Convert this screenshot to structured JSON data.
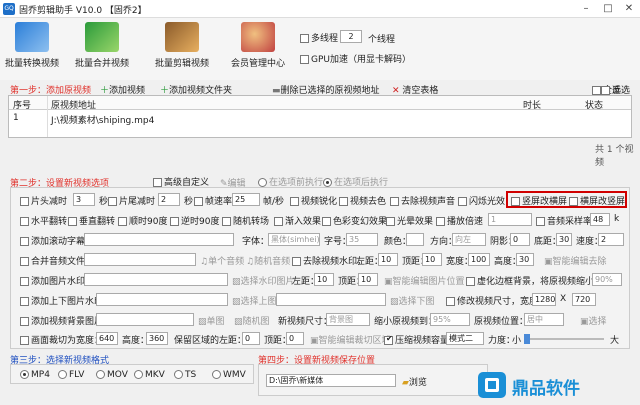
{
  "window": {
    "title": "固乔剪辑助手 V10.0 【固乔2】",
    "logo": "GQ",
    "min": "–",
    "max": "□",
    "close": "✕"
  },
  "toolbar": {
    "buttons": [
      "批量转换视频",
      "批量合并视频",
      "批量剪辑视频",
      "会员管理中心"
    ],
    "multithread": "多线程",
    "thread_count": "2",
    "thread_unit": "个线程",
    "gpu": "GPU加速（用显卡解码）"
  },
  "step1": {
    "title": "第一步：添加原视频",
    "add_video": "添加视频",
    "add_folder": "添加视频文件夹",
    "delete_selected": "删除已选择的原视频地址",
    "clear": "清空表格",
    "select_all": "全选",
    "invert": "反选"
  },
  "grid": {
    "headers": [
      "序号",
      "原视频地址",
      "时长",
      "状态"
    ],
    "rows": [
      {
        "no": "1",
        "path": "J:\\视频素材\\shiping.mp4",
        "duration": "",
        "status": ""
      }
    ],
    "count": "共 1 个视频"
  },
  "step2": {
    "title": "第二步：设置新视频选项",
    "advanced": "高级自定义",
    "edit": "编辑",
    "before": "在选项前执行",
    "after": "在选项后执行"
  },
  "row1": {
    "cut_head": "片头减时",
    "cut_head_val": "3",
    "sec1": "秒",
    "cut_tail": "片尾减时",
    "cut_tail_val": "2",
    "sec2": "秒",
    "fps": "帧速率：",
    "fps_val": "25",
    "fps_unit": "帧/秒",
    "sharpen": "视频锐化",
    "decolor": "视频去色",
    "mute": "去除视频声音",
    "flash": "闪烁光效",
    "v2h": "竖屏改横屏",
    "h2v": "横屏改竖屏"
  },
  "row2": {
    "hflip": "水平翻转",
    "vflip": "垂直翻转",
    "cw90": "顺时90度",
    "ccw90": "逆时90度",
    "rand_trans": "随机转场",
    "fade_in": "渐入效果",
    "color_shift": "色彩变幻效果",
    "light": "光晕效果",
    "speed": "播放倍速",
    "speed_val": "1",
    "sample_rate": "音频采样率：",
    "sample_val": "48",
    "k": "k"
  },
  "row3": {
    "scroll_sub": "添加滚动字幕：",
    "font": "字体：",
    "font_val": "黑体(simhei)",
    "size": "字号：",
    "size_val": "35",
    "color": "颜色：",
    "direction": "方向：",
    "dir_val": "向左",
    "shadow": "阴影：",
    "shadow_val": "0",
    "bottom": "底距：",
    "bottom_val": "30",
    "speed": "速度：",
    "speed_val": "2"
  },
  "row4": {
    "merge_audio": "合并音频文件",
    "single_audio": "单个音频",
    "rand_audio": "随机音频",
    "remove_wm": "去除视频水印，",
    "left": "左距：",
    "left_val": "10",
    "top": "顶距：",
    "top_val": "10",
    "width": "宽度：",
    "width_val": "100",
    "height": "高度：",
    "height_val": "30",
    "smart_remove": "智能编辑去除"
  },
  "row5": {
    "img_wm": "添加图片水印：",
    "choose_img": "选择水印图片",
    "left": "左距：",
    "left_val": "10",
    "top": "顶距：",
    "top_val": "10",
    "smart_img": "智能编辑图片位置",
    "blur_bg": "虚化边框背景，将原视频缩小到：",
    "blur_val": "90%"
  },
  "row6": {
    "tb_wm": "添加上下图片水印：",
    "choose_top": "选择上图",
    "choose_bottom": "选择下图",
    "resize": "修改视频尺寸，宽度：",
    "w_val": "1280",
    "x": "X",
    "h_val": "720"
  },
  "row7": {
    "bg_img": "添加视频背景图片：",
    "single": "单图",
    "random": "随机图",
    "new_size": "新视频尺寸：",
    "size_val": "背景图",
    "scale_to": "缩小原视频到：",
    "scale_val": "95%",
    "pos": "原视频位置：",
    "pos_val": "居中",
    "pick": "选择"
  },
  "row8": {
    "crop": "画面裁切为宽度：",
    "crop_w": "640",
    "height": "高度：",
    "crop_h": "360",
    "keep_left": "保留区域的左距：",
    "keep_left_val": "0",
    "top": "顶距：",
    "top_val": "0",
    "smart_crop": "智能编辑裁切区域",
    "compress": "压缩视频容量",
    "mode": "模式二",
    "strength": "力度：",
    "small": "小",
    "big": "大"
  },
  "step3": {
    "title": "第三步：选择新视频格式",
    "formats": [
      "MP4",
      "FLV",
      "MOV",
      "MKV",
      "TS",
      "WMV"
    ]
  },
  "step4": {
    "title": "第四步：设置新视频保存位置",
    "path": "D:\\固乔\\新媒体",
    "browse": "浏览"
  },
  "brand": {
    "text": "鼎品软件",
    "color": "#1a8fd6"
  },
  "colors": {
    "accent": "#e0322c",
    "highlight": "#d00000"
  }
}
